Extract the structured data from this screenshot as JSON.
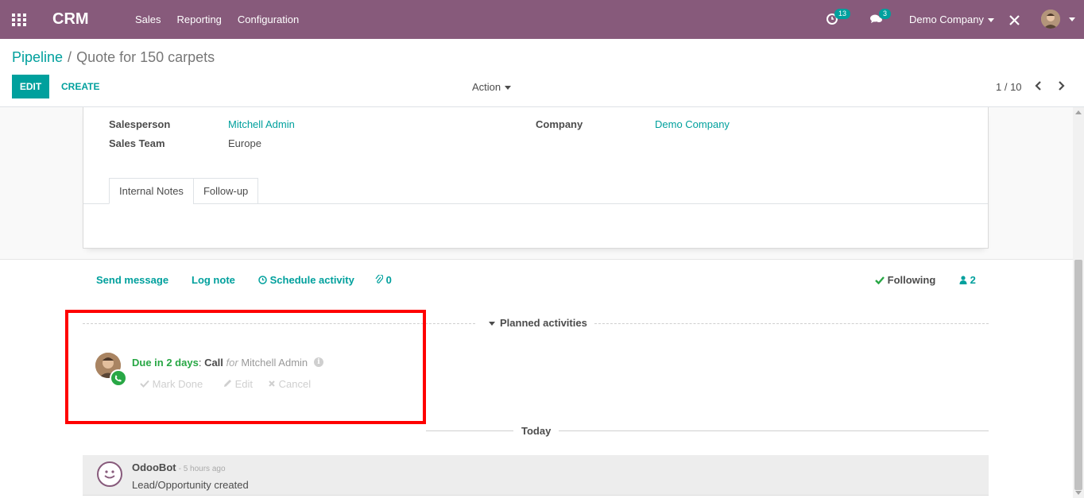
{
  "navbar": {
    "brand": "CRM",
    "menu": [
      "Sales",
      "Reporting",
      "Configuration"
    ],
    "activity_count": "13",
    "message_count": "3",
    "company": "Demo Company"
  },
  "breadcrumb": {
    "parent": "Pipeline",
    "separator": "/",
    "current": "Quote for 150 carpets"
  },
  "control_panel": {
    "edit_label": "EDIT",
    "create_label": "CREATE",
    "action_label": "Action",
    "pager": "1 / 10"
  },
  "form": {
    "salesperson_label": "Salesperson",
    "salesperson_value": "Mitchell Admin",
    "sales_team_label": "Sales Team",
    "sales_team_value": "Europe",
    "company_label": "Company",
    "company_value": "Demo Company",
    "tabs": [
      "Internal Notes",
      "Follow-up"
    ]
  },
  "chatter": {
    "send_message": "Send message",
    "log_note": "Log note",
    "schedule_activity": "Schedule activity",
    "attachments": "0",
    "following": "Following",
    "followers": "2",
    "planned_title": "Planned activities",
    "activity": {
      "due": "Due in 2 days",
      "colon": ":",
      "type": "Call",
      "for": "for",
      "user": "Mitchell Admin",
      "mark_done": "Mark Done",
      "edit": "Edit",
      "cancel": "Cancel"
    },
    "today_label": "Today",
    "message": {
      "author": "OdooBot",
      "date": "- 5 hours ago",
      "body": "Lead/Opportunity created"
    }
  },
  "colors": {
    "navbar": "#875a7b",
    "accent": "#00a09d",
    "due": "#28a745",
    "highlight": "#ff0000"
  }
}
